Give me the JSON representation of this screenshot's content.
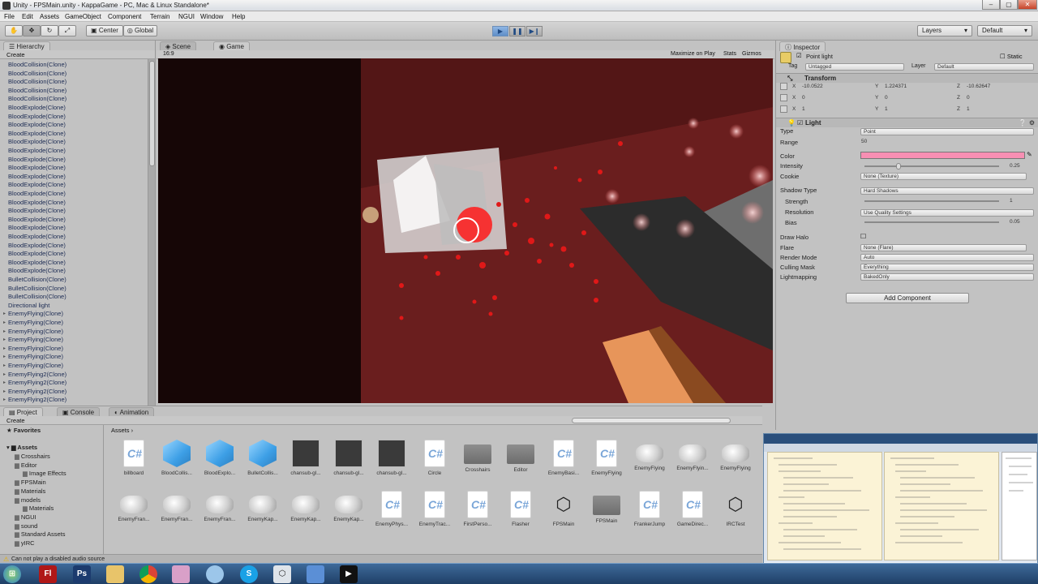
{
  "window": {
    "title": "Unity - FPSMain.unity - KappaGame - PC, Mac & Linux Standalone*",
    "min": "–",
    "max": "▢",
    "close": "✕"
  },
  "menu": [
    "File",
    "Edit",
    "Assets",
    "GameObject",
    "Component",
    "Terrain",
    "NGUI",
    "Window",
    "Help"
  ],
  "toolbar": {
    "center": "Center",
    "global": "Global",
    "layers": "Layers",
    "layout": "Default"
  },
  "hierarchy": {
    "tab": "Hierarchy",
    "create": "Create",
    "items": [
      "BloodCollision(Clone)",
      "BloodCollision(Clone)",
      "BloodCollision(Clone)",
      "BloodCollision(Clone)",
      "BloodCollision(Clone)",
      "BloodExplode(Clone)",
      "BloodExplode(Clone)",
      "BloodExplode(Clone)",
      "BloodExplode(Clone)",
      "BloodExplode(Clone)",
      "BloodExplode(Clone)",
      "BloodExplode(Clone)",
      "BloodExplode(Clone)",
      "BloodExplode(Clone)",
      "BloodExplode(Clone)",
      "BloodExplode(Clone)",
      "BloodExplode(Clone)",
      "BloodExplode(Clone)",
      "BloodExplode(Clone)",
      "BloodExplode(Clone)",
      "BloodExplode(Clone)",
      "BloodExplode(Clone)",
      "BloodExplode(Clone)",
      "BloodExplode(Clone)",
      "BloodExplode(Clone)",
      "BulletCollision(Clone)",
      "BulletCollision(Clone)",
      "BulletCollision(Clone)",
      "Directional light",
      "EnemyFlying(Clone)",
      "EnemyFlying(Clone)",
      "EnemyFlying(Clone)",
      "EnemyFlying(Clone)",
      "EnemyFlying(Clone)",
      "EnemyFlying(Clone)",
      "EnemyFlying(Clone)",
      "EnemyFlying2(Clone)",
      "EnemyFlying2(Clone)",
      "EnemyFlying2(Clone)",
      "EnemyFlying2(Clone)"
    ]
  },
  "view": {
    "scene_tab": "Scene",
    "game_tab": "Game",
    "aspect": "16:9",
    "maximize": "Maximize on Play",
    "stats": "Stats",
    "gizmos": "Gizmos"
  },
  "inspector": {
    "tab": "Inspector",
    "object_name": "Point light",
    "static": "Static",
    "tag_label": "Tag",
    "tag": "Untagged",
    "layer_label": "Layer",
    "layer": "Default",
    "transform": {
      "title": "Transform",
      "pos": {
        "x": "-10.0522",
        "y": "1.224371",
        "z": "-10.62647"
      },
      "rot": {
        "x": "0",
        "y": "0",
        "z": "0"
      },
      "scale": {
        "x": "1",
        "y": "1",
        "z": "1"
      },
      "px": "X",
      "py": "Y",
      "pz": "Z"
    },
    "light": {
      "title": "Light",
      "type_label": "Type",
      "type": "Point",
      "range_label": "Range",
      "range": "50",
      "color_label": "Color",
      "color": "#f78fb3",
      "intensity_label": "Intensity",
      "intensity": "0.25",
      "intensity_fraction": 0.25,
      "cookie_label": "Cookie",
      "cookie": "None (Texture)",
      "shadow_label": "Shadow Type",
      "shadow": "Hard Shadows",
      "strength_label": "Strength",
      "strength": "1",
      "resolution_label": "Resolution",
      "resolution": "Use Quality Settings",
      "bias_label": "Bias",
      "bias": "0.05",
      "halo_label": "Draw Halo",
      "flare_label": "Flare",
      "flare": "None (Flare)",
      "render_label": "Render Mode",
      "render": "Auto",
      "culling_label": "Culling Mask",
      "culling": "Everything",
      "lightmap_label": "Lightmapping",
      "lightmap": "BakedOnly"
    },
    "add_component": "Add Component"
  },
  "bottom": {
    "project_tab": "Project",
    "console_tab": "Console",
    "animation_tab": "Animation",
    "create": "Create",
    "favorites": "Favorites",
    "assets_root": "Assets",
    "breadcrumb": "Assets ›",
    "tree": [
      "Crosshairs",
      "Editor",
      "Image Effects",
      "FPSMain",
      "Materials",
      "models",
      "Materials",
      "NGUI",
      "sound",
      "Standard Assets",
      "yIRC"
    ],
    "row1": [
      {
        "n": "billboard",
        "t": "cs"
      },
      {
        "n": "BloodCollis...",
        "t": "cube"
      },
      {
        "n": "BloodExplo...",
        "t": "cube"
      },
      {
        "n": "BulletCollis...",
        "t": "cube"
      },
      {
        "n": "chansub-gl...",
        "t": "photo"
      },
      {
        "n": "chansub-gl...",
        "t": "photo"
      },
      {
        "n": "chansub-gl...",
        "t": "photo"
      },
      {
        "n": "Circle",
        "t": "cs"
      },
      {
        "n": "Crosshairs",
        "t": "folder"
      },
      {
        "n": "Editor",
        "t": "folder"
      },
      {
        "n": "EnemyBasi...",
        "t": "cs"
      },
      {
        "n": "EnemyFlying",
        "t": "cs"
      },
      {
        "n": "EnemyFlying",
        "t": "model"
      },
      {
        "n": "EnemyFlyin...",
        "t": "model"
      },
      {
        "n": "EnemyFlying",
        "t": "model"
      }
    ],
    "row2": [
      {
        "n": "EnemyFran...",
        "t": "model"
      },
      {
        "n": "EnemyFran...",
        "t": "model"
      },
      {
        "n": "EnemyFran...",
        "t": "model"
      },
      {
        "n": "EnemyKap...",
        "t": "model"
      },
      {
        "n": "EnemyKap...",
        "t": "model"
      },
      {
        "n": "EnemyKap...",
        "t": "model"
      },
      {
        "n": "EnemyPhys...",
        "t": "cs"
      },
      {
        "n": "EnemyTrac...",
        "t": "cs"
      },
      {
        "n": "FirstPerso...",
        "t": "cs"
      },
      {
        "n": "Flasher",
        "t": "cs"
      },
      {
        "n": "FPSMain",
        "t": "unity"
      },
      {
        "n": "FPSMain",
        "t": "folder"
      },
      {
        "n": "FrankerJump",
        "t": "cs"
      },
      {
        "n": "GameDirec...",
        "t": "cs"
      },
      {
        "n": "IRCTest",
        "t": "unity"
      }
    ],
    "status": "Can not play a disabled audio source"
  },
  "taskbar": {
    "apps": [
      "Fl",
      "Ps",
      "",
      "",
      "",
      "",
      "S",
      "",
      "",
      ""
    ]
  }
}
